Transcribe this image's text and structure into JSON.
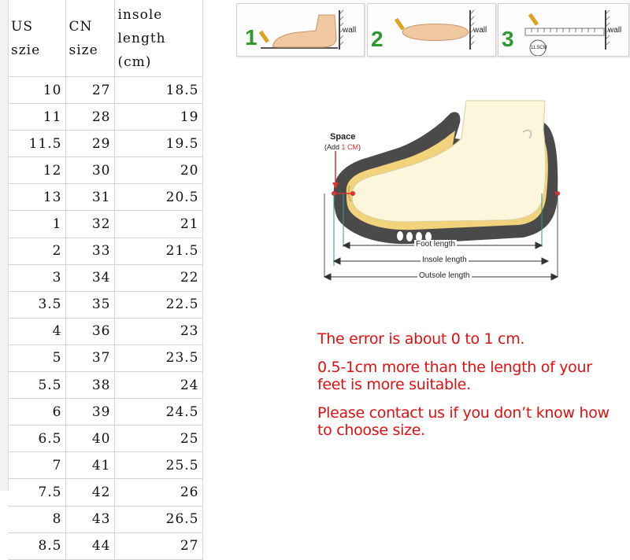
{
  "table": {
    "headers": {
      "us": "US\nszie",
      "cn": "CN\nsize",
      "insole": "insole\nlength\n(cm)"
    },
    "rows": [
      {
        "us": "10",
        "cn": "27",
        "insole": "18.5"
      },
      {
        "us": "11",
        "cn": "28",
        "insole": "19"
      },
      {
        "us": "11.5",
        "cn": "29",
        "insole": "19.5"
      },
      {
        "us": "12",
        "cn": "30",
        "insole": "20"
      },
      {
        "us": "13",
        "cn": "31",
        "insole": "20.5"
      },
      {
        "us": "1",
        "cn": "32",
        "insole": "21"
      },
      {
        "us": "2",
        "cn": "33",
        "insole": "21.5"
      },
      {
        "us": "3",
        "cn": "34",
        "insole": "22"
      },
      {
        "us": "3.5",
        "cn": "35",
        "insole": "22.5"
      },
      {
        "us": "4",
        "cn": "36",
        "insole": "23"
      },
      {
        "us": "5",
        "cn": "37",
        "insole": "23.5"
      },
      {
        "us": "5.5",
        "cn": "38",
        "insole": "24"
      },
      {
        "us": "6",
        "cn": "39",
        "insole": "24.5"
      },
      {
        "us": "6.5",
        "cn": "40",
        "insole": "25"
      },
      {
        "us": "7",
        "cn": "41",
        "insole": "25.5"
      },
      {
        "us": "7.5",
        "cn": "42",
        "insole": "26"
      },
      {
        "us": "8",
        "cn": "43",
        "insole": "26.5"
      },
      {
        "us": "8.5",
        "cn": "44",
        "insole": "27"
      }
    ]
  },
  "steps": [
    {
      "number": "1",
      "wall_label": "wall"
    },
    {
      "number": "2",
      "wall_label": "wall"
    },
    {
      "number": "3",
      "wall_label": "wall",
      "badge": "11.5CM"
    }
  ],
  "diagram": {
    "space_label": "Space",
    "space_sub_prefix": "(Add ",
    "space_sub_value": "1 CM",
    "space_sub_suffix": ")",
    "foot_length": "Foot  length",
    "insole_length": "Insole  length",
    "outsole_length": "Outsole  length"
  },
  "notes": [
    "The error is about 0 to 1 cm.",
    "0.5-1cm more than the length of your feet is more suitable.",
    "Please contact us if you don’t know how to choose size."
  ],
  "colors": {
    "note_text": "#e01010",
    "step_number": "#2e9a2e",
    "space_accent": "#e03030",
    "sole": "#4a4a4a",
    "insole": "#f2d27a",
    "foot": "#fbf6dc"
  }
}
